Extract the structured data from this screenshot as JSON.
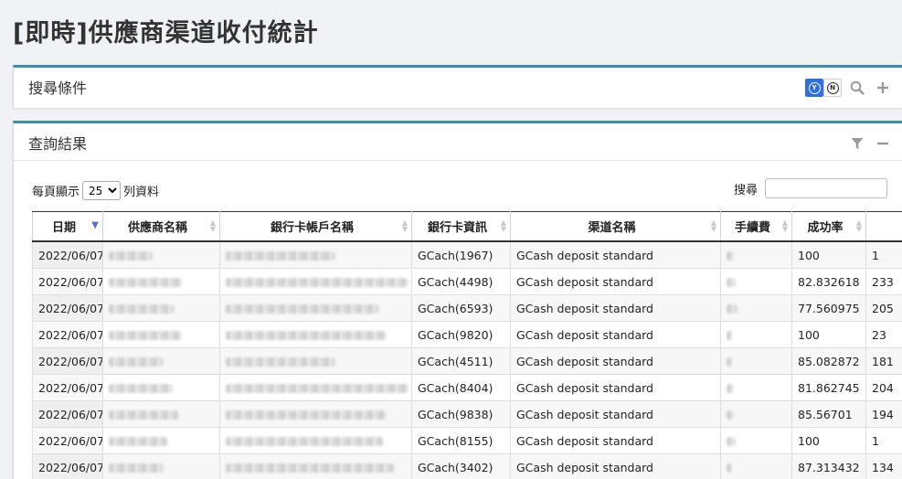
{
  "page": {
    "title": "[即時]供應商渠道收付統計"
  },
  "search_panel": {
    "title": "搜尋條件",
    "toggle_on": "Y",
    "toggle_off": "N"
  },
  "results_panel": {
    "title": "查詢結果",
    "length_prefix": "每頁顯示",
    "length_value": "25",
    "length_suffix": "列資料",
    "search_label": "搜尋",
    "search_value": ""
  },
  "table": {
    "columns": [
      "日期",
      "供應商名稱",
      "銀行卡帳戶名稱",
      "銀行卡資訊",
      "渠道名稱",
      "手續費",
      "成功率",
      ""
    ],
    "rows": [
      {
        "date": "2022/06/07",
        "card_info": "GCach(1967)",
        "channel": "GCash deposit standard",
        "success_rate": "100",
        "last": "1"
      },
      {
        "date": "2022/06/07",
        "card_info": "GCach(4498)",
        "channel": "GCash deposit standard",
        "success_rate": "82.832618",
        "last": "233"
      },
      {
        "date": "2022/06/07",
        "card_info": "GCach(6593)",
        "channel": "GCash deposit standard",
        "success_rate": "77.560975",
        "last": "205"
      },
      {
        "date": "2022/06/07",
        "card_info": "GCach(9820)",
        "channel": "GCash deposit standard",
        "success_rate": "100",
        "last": "23"
      },
      {
        "date": "2022/06/07",
        "card_info": "GCach(4511)",
        "channel": "GCash deposit standard",
        "success_rate": "85.082872",
        "last": "181"
      },
      {
        "date": "2022/06/07",
        "card_info": "GCach(8404)",
        "channel": "GCash deposit standard",
        "success_rate": "81.862745",
        "last": "204"
      },
      {
        "date": "2022/06/07",
        "card_info": "GCach(9838)",
        "channel": "GCash deposit standard",
        "success_rate": "85.56701",
        "last": "194"
      },
      {
        "date": "2022/06/07",
        "card_info": "GCach(8155)",
        "channel": "GCash deposit standard",
        "success_rate": "100",
        "last": "1"
      },
      {
        "date": "2022/06/07",
        "card_info": "GCach(3402)",
        "channel": "GCash deposit standard",
        "success_rate": "87.313432",
        "last": "134"
      }
    ]
  }
}
